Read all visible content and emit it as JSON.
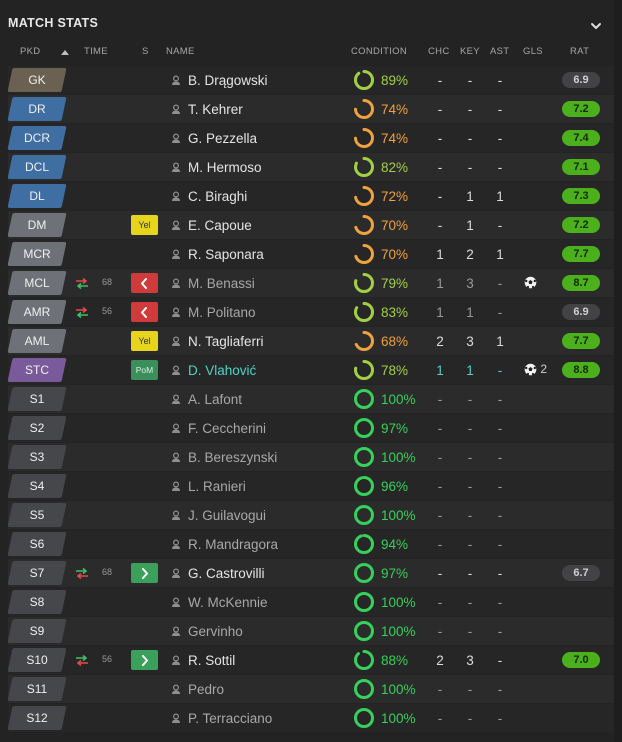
{
  "header": {
    "title": "MATCH STATS"
  },
  "columns": {
    "pkd": "PKD",
    "time": "TIME",
    "s": "S",
    "name": "NAME",
    "condition": "CONDITION",
    "chc": "CHC",
    "key": "KEY",
    "ast": "AST",
    "gls": "GLS",
    "rat": "RAT"
  },
  "colors": {
    "pos_gk": "#6b6152",
    "pos_def": "#3f6ea3",
    "pos_mid": "#6e7278",
    "pos_st": "#7a5a9a",
    "pos_sub": "#45474a",
    "cond_green": "#36d05a",
    "cond_lime": "#a2d044",
    "cond_orange": "#f0a23c",
    "rating_green": "#4bb01c",
    "rating_grey": "#434345",
    "highlight_teal": "#4fd3c4"
  },
  "rows": [
    {
      "pos": "GK",
      "pos_color": "#6b6152",
      "name": "B. Drągowski",
      "cond": "89%",
      "cond_val": 89,
      "cond_color": "#a2d044",
      "chc": "-",
      "key": "-",
      "ast": "-",
      "rat": "6.9",
      "rat_style": "grey"
    },
    {
      "pos": "DR",
      "pos_color": "#3f6ea3",
      "name": "T. Kehrer",
      "cond": "74%",
      "cond_val": 74,
      "cond_color": "#f0a23c",
      "chc": "-",
      "key": "-",
      "ast": "-",
      "rat": "7.2",
      "rat_style": "green"
    },
    {
      "pos": "DCR",
      "pos_color": "#3f6ea3",
      "name": "G. Pezzella",
      "cond": "74%",
      "cond_val": 74,
      "cond_color": "#f0a23c",
      "chc": "-",
      "key": "-",
      "ast": "-",
      "rat": "7.4",
      "rat_style": "green"
    },
    {
      "pos": "DCL",
      "pos_color": "#3f6ea3",
      "name": "M. Hermoso",
      "cond": "82%",
      "cond_val": 82,
      "cond_color": "#a2d044",
      "chc": "-",
      "key": "-",
      "ast": "-",
      "rat": "7.1",
      "rat_style": "green"
    },
    {
      "pos": "DL",
      "pos_color": "#3f6ea3",
      "name": "C. Biraghi",
      "cond": "72%",
      "cond_val": 72,
      "cond_color": "#f0a23c",
      "chc": "-",
      "key": "1",
      "ast": "1",
      "rat": "7.3",
      "rat_style": "green"
    },
    {
      "pos": "DM",
      "pos_color": "#6e7278",
      "badge": "Yel",
      "name": "E. Capoue",
      "cond": "70%",
      "cond_val": 70,
      "cond_color": "#f0a23c",
      "chc": "-",
      "key": "1",
      "ast": "-",
      "rat": "7.2",
      "rat_style": "green"
    },
    {
      "pos": "MCR",
      "pos_color": "#6e7278",
      "name": "R. Saponara",
      "cond": "70%",
      "cond_val": 70,
      "cond_color": "#f0a23c",
      "chc": "1",
      "key": "2",
      "ast": "1",
      "rat": "7.7",
      "rat_style": "green"
    },
    {
      "pos": "MCL",
      "pos_color": "#6e7278",
      "sub": "out",
      "time": "68",
      "badge_arrow": "out",
      "name": "M. Benassi",
      "dim": true,
      "cond": "79%",
      "cond_val": 79,
      "cond_color": "#a2d044",
      "chc": "1",
      "key": "3",
      "ast": "-",
      "gls_ball": true,
      "gls": "",
      "rat": "8.7",
      "rat_style": "green"
    },
    {
      "pos": "AMR",
      "pos_color": "#6e7278",
      "sub": "out",
      "time": "56",
      "badge_arrow": "out",
      "name": "M. Politano",
      "dim": true,
      "cond": "83%",
      "cond_val": 83,
      "cond_color": "#a2d044",
      "chc": "1",
      "key": "1",
      "ast": "-",
      "rat": "6.9",
      "rat_style": "grey"
    },
    {
      "pos": "AML",
      "pos_color": "#6e7278",
      "badge": "Yel",
      "name": "N. Tagliaferri",
      "cond": "68%",
      "cond_val": 68,
      "cond_color": "#f0a23c",
      "chc": "2",
      "key": "3",
      "ast": "1",
      "rat": "7.7",
      "rat_style": "green"
    },
    {
      "pos": "STC",
      "pos_color": "#7a5a9a",
      "badge": "PoM",
      "name": "D. Vlahović",
      "star": true,
      "cond": "78%",
      "cond_val": 78,
      "cond_color": "#a2d044",
      "chc": "1",
      "key": "1",
      "ast": "-",
      "gls_ball": true,
      "gls": "2",
      "rat": "8.8",
      "rat_style": "green"
    },
    {
      "pos": "S1",
      "pos_color": "#45474a",
      "name": "A. Lafont",
      "dim": true,
      "cond": "100%",
      "cond_val": 100,
      "cond_color": "#36d05a",
      "chc": "-",
      "key": "-",
      "ast": "-",
      "rat": "",
      "rat_style": ""
    },
    {
      "pos": "S2",
      "pos_color": "#45474a",
      "name": "F. Ceccherini",
      "dim": true,
      "cond": "97%",
      "cond_val": 97,
      "cond_color": "#36d05a",
      "chc": "-",
      "key": "-",
      "ast": "-",
      "rat": "",
      "rat_style": ""
    },
    {
      "pos": "S3",
      "pos_color": "#45474a",
      "name": "B. Bereszynski",
      "dim": true,
      "cond": "100%",
      "cond_val": 100,
      "cond_color": "#36d05a",
      "chc": "-",
      "key": "-",
      "ast": "-",
      "rat": "",
      "rat_style": ""
    },
    {
      "pos": "S4",
      "pos_color": "#45474a",
      "name": "L. Ranieri",
      "dim": true,
      "cond": "96%",
      "cond_val": 96,
      "cond_color": "#36d05a",
      "chc": "-",
      "key": "-",
      "ast": "-",
      "rat": "",
      "rat_style": ""
    },
    {
      "pos": "S5",
      "pos_color": "#45474a",
      "name": "J. Guilavogui",
      "dim": true,
      "cond": "100%",
      "cond_val": 100,
      "cond_color": "#36d05a",
      "chc": "-",
      "key": "-",
      "ast": "-",
      "rat": "",
      "rat_style": ""
    },
    {
      "pos": "S6",
      "pos_color": "#45474a",
      "name": "R. Mandragora",
      "dim": true,
      "cond": "94%",
      "cond_val": 94,
      "cond_color": "#36d05a",
      "chc": "-",
      "key": "-",
      "ast": "-",
      "rat": "",
      "rat_style": ""
    },
    {
      "pos": "S7",
      "pos_color": "#45474a",
      "sub": "in",
      "time": "68",
      "badge_arrow": "in",
      "name": "G. Castrovilli",
      "cond": "97%",
      "cond_val": 97,
      "cond_color": "#36d05a",
      "chc": "-",
      "key": "-",
      "ast": "-",
      "rat": "6.7",
      "rat_style": "grey"
    },
    {
      "pos": "S8",
      "pos_color": "#45474a",
      "name": "W. McKennie",
      "dim": true,
      "cond": "100%",
      "cond_val": 100,
      "cond_color": "#36d05a",
      "chc": "-",
      "key": "-",
      "ast": "-",
      "rat": "",
      "rat_style": ""
    },
    {
      "pos": "S9",
      "pos_color": "#45474a",
      "name": "Gervinho",
      "dim": true,
      "cond": "100%",
      "cond_val": 100,
      "cond_color": "#36d05a",
      "chc": "-",
      "key": "-",
      "ast": "-",
      "rat": "",
      "rat_style": ""
    },
    {
      "pos": "S10",
      "pos_color": "#45474a",
      "sub": "in",
      "time": "56",
      "badge_arrow": "in",
      "name": "R. Sottil",
      "cond": "88%",
      "cond_val": 88,
      "cond_color": "#36d05a",
      "chc": "2",
      "key": "3",
      "ast": "-",
      "rat": "7.0",
      "rat_style": "green"
    },
    {
      "pos": "S11",
      "pos_color": "#45474a",
      "name": "Pedro",
      "dim": true,
      "cond": "100%",
      "cond_val": 100,
      "cond_color": "#36d05a",
      "chc": "-",
      "key": "-",
      "ast": "-",
      "rat": "",
      "rat_style": ""
    },
    {
      "pos": "S12",
      "pos_color": "#45474a",
      "name": "P. Terracciano",
      "dim": true,
      "cond": "100%",
      "cond_val": 100,
      "cond_color": "#36d05a",
      "chc": "-",
      "key": "-",
      "ast": "-",
      "rat": "",
      "rat_style": ""
    }
  ]
}
